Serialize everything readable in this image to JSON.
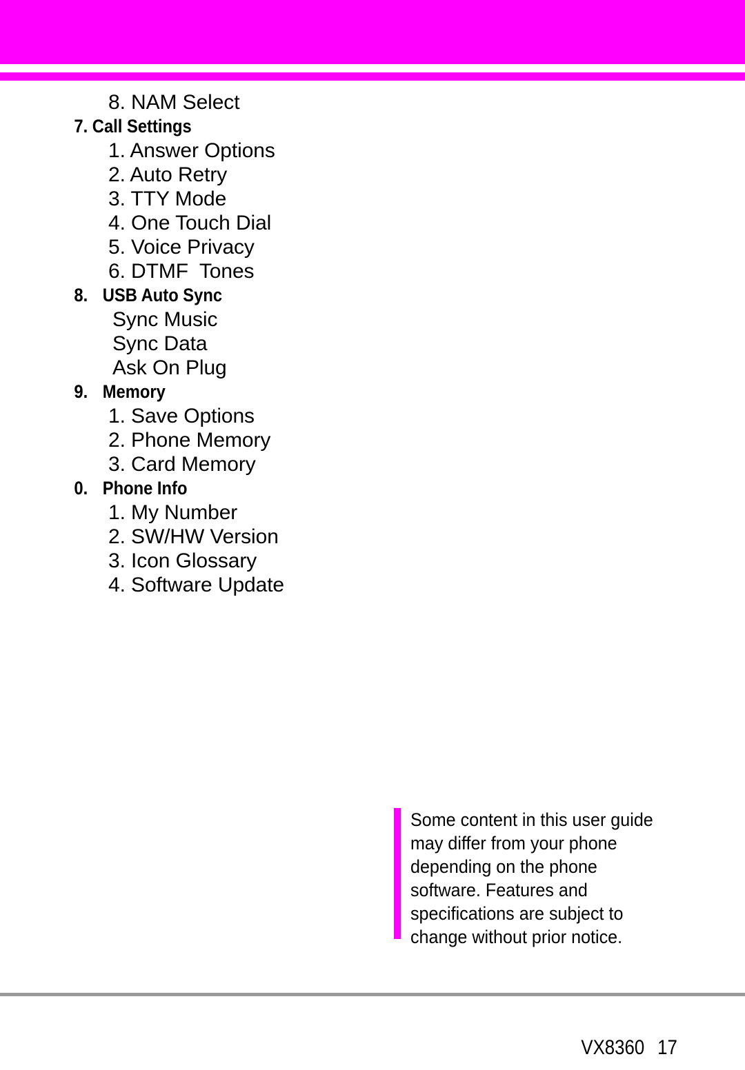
{
  "page": {
    "accent_color": "#ff00ff",
    "rule_color": "#9a9a9a",
    "background": "#ffffff"
  },
  "menu": {
    "lines": [
      {
        "kind": "sub",
        "text": "8. NAM Select"
      },
      {
        "kind": "section",
        "number": "7.",
        "title": "Call Settings",
        "tabbed": false
      },
      {
        "kind": "sub",
        "text": "1. Answer Options"
      },
      {
        "kind": "sub",
        "text": "2. Auto Retry"
      },
      {
        "kind": "sub",
        "text": "3. TTY Mode"
      },
      {
        "kind": "sub",
        "text": "4. One Touch Dial"
      },
      {
        "kind": "sub",
        "text": "5. Voice Privacy"
      },
      {
        "kind": "sub",
        "text": "6. DTMF  Tones"
      },
      {
        "kind": "section",
        "number": "8.",
        "title": "USB Auto Sync",
        "tabbed": true
      },
      {
        "kind": "sub-noindex",
        "text": "Sync Music"
      },
      {
        "kind": "sub-noindex",
        "text": "Sync Data"
      },
      {
        "kind": "sub-noindex",
        "text": "Ask On Plug"
      },
      {
        "kind": "section",
        "number": "9.",
        "title": "Memory",
        "tabbed": true
      },
      {
        "kind": "sub",
        "text": "1. Save Options"
      },
      {
        "kind": "sub",
        "text": "2. Phone Memory"
      },
      {
        "kind": "sub",
        "text": "3. Card Memory"
      },
      {
        "kind": "section",
        "number": "0.",
        "title": "Phone Info",
        "tabbed": true
      },
      {
        "kind": "sub",
        "text": "1. My Number"
      },
      {
        "kind": "sub",
        "text": "2. SW/HW Version"
      },
      {
        "kind": "sub",
        "text": "3. Icon Glossary"
      },
      {
        "kind": "sub",
        "text": "4. Software Update"
      }
    ]
  },
  "note": {
    "lines": [
      "Some content in this user guide",
      "may differ from your phone",
      "depending on the phone",
      "software. Features and",
      "specifications are subject to",
      "change without prior notice."
    ]
  },
  "footer": {
    "model": "VX8360",
    "page_number": "17"
  }
}
